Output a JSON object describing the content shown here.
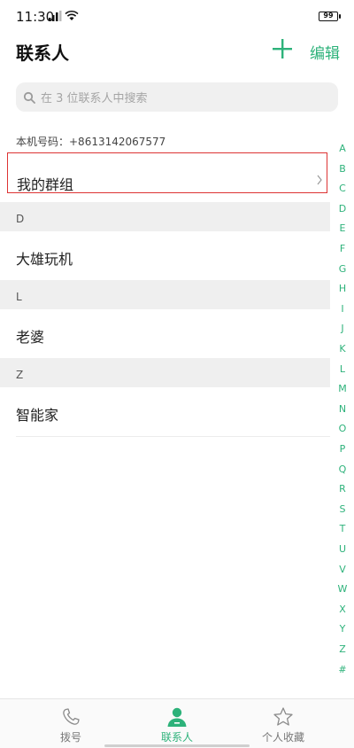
{
  "status": {
    "time": "11:30",
    "battery": "99"
  },
  "header": {
    "title": "联系人",
    "edit_label": "编辑"
  },
  "search": {
    "placeholder": "在 3 位联系人中搜索"
  },
  "my_number": "本机号码：+8613142067577",
  "groups_label": "我的群组",
  "sections": [
    {
      "letter": "D",
      "contacts": [
        "大雄玩机"
      ]
    },
    {
      "letter": "L",
      "contacts": [
        "老婆"
      ]
    },
    {
      "letter": "Z",
      "contacts": [
        "智能家"
      ]
    }
  ],
  "alphabet": [
    "A",
    "B",
    "C",
    "D",
    "E",
    "F",
    "G",
    "H",
    "I",
    "J",
    "K",
    "L",
    "M",
    "N",
    "O",
    "P",
    "Q",
    "R",
    "S",
    "T",
    "U",
    "V",
    "W",
    "X",
    "Y",
    "Z",
    "#"
  ],
  "bottom_nav": [
    {
      "label": "拨号",
      "icon": "phone-icon"
    },
    {
      "label": "联系人",
      "icon": "person-icon",
      "active": true
    },
    {
      "label": "个人收藏",
      "icon": "star-icon"
    }
  ],
  "colors": {
    "accent": "#2db27a",
    "highlight_border": "#dd3333"
  }
}
